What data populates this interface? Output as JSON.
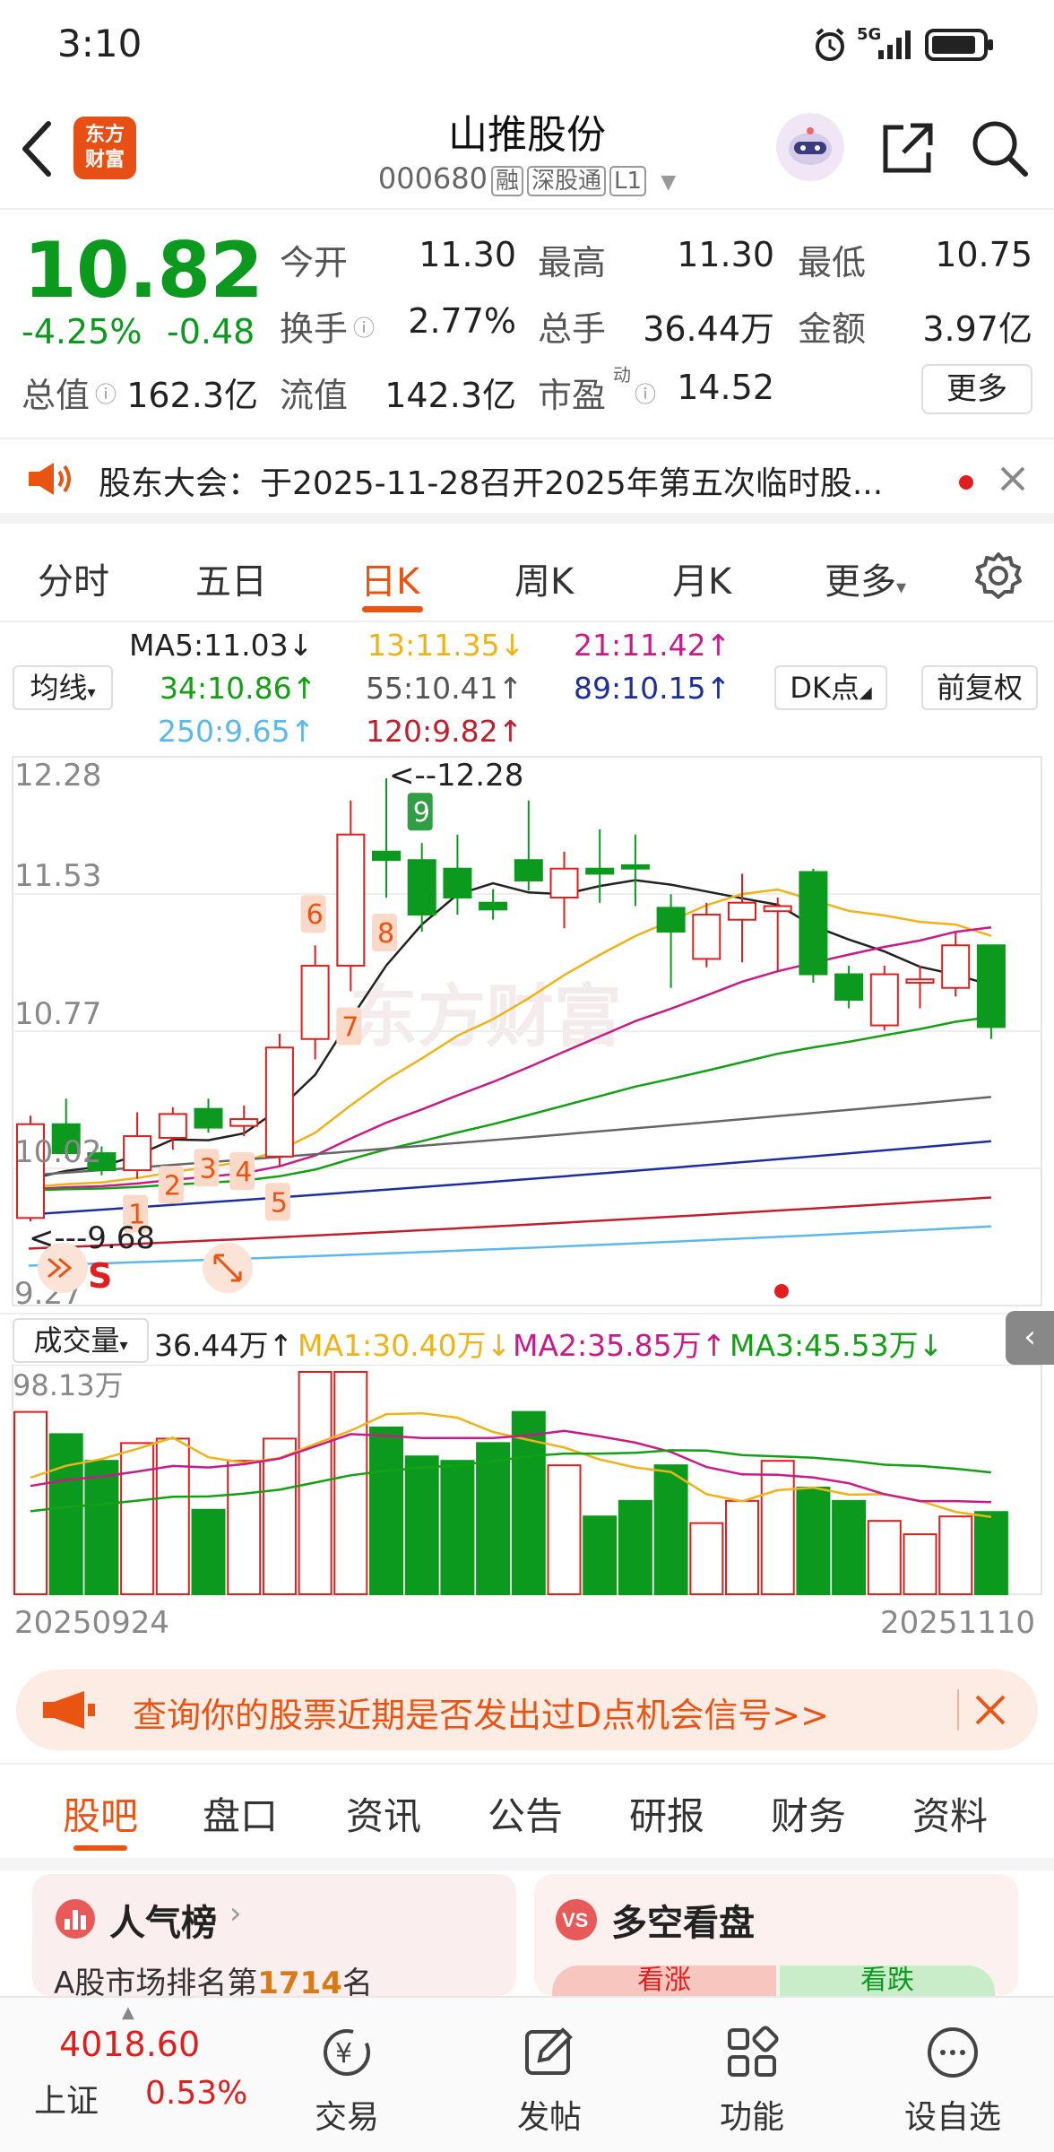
{
  "status_bar": {
    "time": "3:10",
    "network": "5G",
    "icons": [
      "alarm-icon",
      "signal-icon",
      "battery-icon"
    ]
  },
  "header": {
    "logo_line1": "东方",
    "logo_line2": "财富",
    "title": "山推股份",
    "code": "000680",
    "tags": [
      "融",
      "深股通",
      "L1"
    ]
  },
  "quote": {
    "price": "10.82",
    "change_pct": "-4.25%",
    "change": "-0.48",
    "total_value_label": "总值",
    "total_value": "162.3亿",
    "open_label": "今开",
    "open": "11.30",
    "high_label": "最高",
    "high": "11.30",
    "low_label": "最低",
    "low": "10.75",
    "turnover_label": "换手",
    "turnover": "2.77%",
    "volume_label": "总手",
    "volume": "36.44万",
    "amount_label": "金额",
    "amount": "3.97亿",
    "float_label": "流值",
    "float_value": "142.3亿",
    "pe_label": "市盈",
    "pe_sup": "动",
    "pe": "14.52",
    "more_button": "更多"
  },
  "notice": {
    "text": "股东大会：于2025-11-28召开2025年第五次临时股..."
  },
  "chart_tabs": [
    "分时",
    "五日",
    "日K",
    "周K",
    "月K",
    "更多"
  ],
  "active_chart_tab": "日K",
  "indicators": {
    "ma_button": "均线",
    "ma5": "MA5:11.03↓",
    "ma13": "13:11.35↓",
    "ma21": "21:11.42↑",
    "ma34": "34:10.86↑",
    "ma55": "55:10.41↑",
    "ma89": "89:10.15↑",
    "ma250": "250:9.65↑",
    "ma120": "120:9.82↑",
    "dk_button": "DK点",
    "adjust_button": "前复权"
  },
  "kline_labels": {
    "y_top": "12.28",
    "y_2": "11.53",
    "y_3": "10.77",
    "y_4": "10.02",
    "y_bottom": "9.27",
    "max_marker": "<--12.28",
    "min_marker": "<---9.68",
    "sell_marker": "S",
    "watermark": "东方财富",
    "counts": [
      "1",
      "2",
      "3",
      "4",
      "5",
      "6",
      "7",
      "8",
      "9"
    ]
  },
  "volume_panel": {
    "selector": "成交量",
    "vol": "36.44万↑",
    "ma1": "MA1:30.40万↓",
    "ma2": "MA2:35.85万↑",
    "ma3": "MA3:45.53万↓",
    "y_top": "98.13万",
    "date_start": "20250924",
    "date_end": "20251110"
  },
  "chart_data": {
    "type": "candlestick",
    "title": "",
    "ylim": [
      9.27,
      12.28
    ],
    "candles": [
      {
        "o": 9.7,
        "h": 10.3,
        "l": 9.68,
        "c": 10.25
      },
      {
        "o": 10.25,
        "h": 10.4,
        "l": 10.05,
        "c": 10.08
      },
      {
        "o": 10.08,
        "h": 10.12,
        "l": 9.95,
        "c": 9.98
      },
      {
        "o": 9.98,
        "h": 10.32,
        "l": 9.93,
        "c": 10.18
      },
      {
        "o": 10.17,
        "h": 10.35,
        "l": 10.1,
        "c": 10.31
      },
      {
        "o": 10.34,
        "h": 10.4,
        "l": 10.2,
        "c": 10.23
      },
      {
        "o": 10.24,
        "h": 10.36,
        "l": 10.18,
        "c": 10.28
      },
      {
        "o": 10.06,
        "h": 10.78,
        "l": 10.0,
        "c": 10.7
      },
      {
        "o": 10.75,
        "h": 11.3,
        "l": 10.63,
        "c": 11.18
      },
      {
        "o": 11.18,
        "h": 12.15,
        "l": 11.03,
        "c": 11.95
      },
      {
        "o": 11.85,
        "h": 12.28,
        "l": 11.58,
        "c": 11.8
      },
      {
        "o": 11.8,
        "h": 11.9,
        "l": 11.38,
        "c": 11.48
      },
      {
        "o": 11.75,
        "h": 11.95,
        "l": 11.48,
        "c": 11.58
      },
      {
        "o": 11.55,
        "h": 11.63,
        "l": 11.45,
        "c": 11.51
      },
      {
        "o": 11.8,
        "h": 12.15,
        "l": 11.62,
        "c": 11.68
      },
      {
        "o": 11.58,
        "h": 11.85,
        "l": 11.4,
        "c": 11.75
      },
      {
        "o": 11.75,
        "h": 11.98,
        "l": 11.55,
        "c": 11.72
      },
      {
        "o": 11.77,
        "h": 11.95,
        "l": 11.53,
        "c": 11.75
      },
      {
        "o": 11.52,
        "h": 11.6,
        "l": 11.05,
        "c": 11.38
      },
      {
        "o": 11.22,
        "h": 11.55,
        "l": 11.17,
        "c": 11.48
      },
      {
        "o": 11.45,
        "h": 11.72,
        "l": 11.2,
        "c": 11.55
      },
      {
        "o": 11.5,
        "h": 11.58,
        "l": 11.15,
        "c": 11.53
      },
      {
        "o": 11.73,
        "h": 11.75,
        "l": 11.08,
        "c": 11.13
      },
      {
        "o": 11.13,
        "h": 11.18,
        "l": 10.93,
        "c": 10.98
      },
      {
        "o": 10.83,
        "h": 11.18,
        "l": 10.8,
        "c": 11.13
      },
      {
        "o": 11.08,
        "h": 11.18,
        "l": 10.93,
        "c": 11.1
      },
      {
        "o": 11.05,
        "h": 11.38,
        "l": 11.0,
        "c": 11.3
      },
      {
        "o": 11.3,
        "h": 11.3,
        "l": 10.75,
        "c": 10.82
      }
    ],
    "volume": [
      0.82,
      0.72,
      0.6,
      0.68,
      0.7,
      0.38,
      0.6,
      0.7,
      1.0,
      1.0,
      0.75,
      0.62,
      0.6,
      0.68,
      0.82,
      0.58,
      0.35,
      0.42,
      0.58,
      0.32,
      0.42,
      0.6,
      0.48,
      0.42,
      0.33,
      0.27,
      0.35,
      0.37
    ],
    "volume_max": "98.13万",
    "date_range": [
      "20250924",
      "20251110"
    ]
  },
  "banner": {
    "text": "查询你的股票近期是否发出过D点机会信号>>"
  },
  "sub_tabs": [
    "股吧",
    "盘口",
    "资讯",
    "公告",
    "研报",
    "财务",
    "资料"
  ],
  "active_sub_tab": "股吧",
  "cards": {
    "popularity_title": "人气榜",
    "popularity_text_prefix": "A股市场排名第",
    "popularity_rank": "1714",
    "popularity_text_suffix": "名",
    "bullbear_title": "多空看盘",
    "bull_label": "看涨",
    "bear_label": "看跌"
  },
  "bottom_nav": {
    "index_value": "4018.60",
    "index_name": "上证",
    "index_change": "0.53%",
    "trade": "交易",
    "post": "发帖",
    "functions": "功能",
    "watchlist": "设自选"
  },
  "colors": {
    "up": "#e01e1e",
    "down": "#0b9a1e",
    "accent": "#ea5413"
  }
}
